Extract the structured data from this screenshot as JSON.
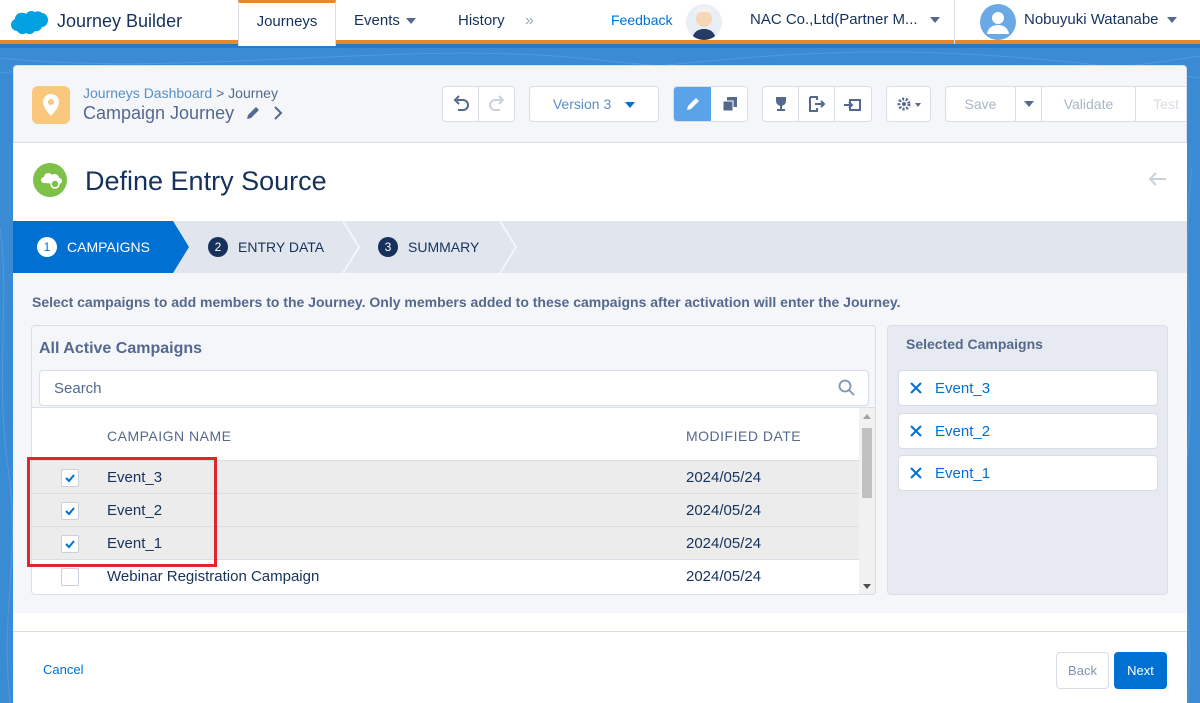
{
  "colors": {
    "brand": "#0070d2",
    "accent_orange": "#e8882c",
    "highlight_red": "#e0262d",
    "entry_icon_green": "#7ec148",
    "pin_yellow": "#f9c87c"
  },
  "topnav": {
    "app_title": "Journey Builder",
    "tabs": [
      {
        "label": "Journeys",
        "active": true
      },
      {
        "label": "Events",
        "has_dropdown": true
      },
      {
        "label": "History"
      }
    ],
    "overflow_icon": "double-chevron-right-icon",
    "feedback": "Feedback",
    "org_name": "NAC Co.,Ltd(Partner M...",
    "user_name": "Nobuyuki Watanabe"
  },
  "journey_header": {
    "breadcrumb_link": "Journeys Dashboard",
    "breadcrumb_sep": ">",
    "breadcrumb_current": "Journey",
    "journey_name": "Campaign Journey",
    "version_label": "Version 3",
    "save_label": "Save",
    "validate_label": "Validate",
    "test_label": "Test"
  },
  "card": {
    "title": "Define Entry Source",
    "steps": [
      {
        "num": "1",
        "label": "CAMPAIGNS",
        "active": true
      },
      {
        "num": "2",
        "label": "ENTRY DATA"
      },
      {
        "num": "3",
        "label": "SUMMARY"
      }
    ],
    "instruction": "Select campaigns to add members to the Journey. Only members added to these campaigns after activation will enter the Journey.",
    "all_campaigns": {
      "title": "All Active Campaigns",
      "search_placeholder": "Search",
      "col_name": "CAMPAIGN NAME",
      "col_date": "MODIFIED DATE",
      "rows": [
        {
          "name": "Event_3",
          "date": "2024/05/24",
          "checked": true
        },
        {
          "name": "Event_2",
          "date": "2024/05/24",
          "checked": true
        },
        {
          "name": "Event_1",
          "date": "2024/05/24",
          "checked": true
        },
        {
          "name": "Webinar Registration Campaign",
          "date": "2024/05/24",
          "checked": false
        }
      ]
    },
    "selected": {
      "title": "Selected Campaigns",
      "items": [
        "Event_3",
        "Event_2",
        "Event_1"
      ]
    },
    "footer": {
      "cancel": "Cancel",
      "back": "Back",
      "next": "Next"
    }
  }
}
